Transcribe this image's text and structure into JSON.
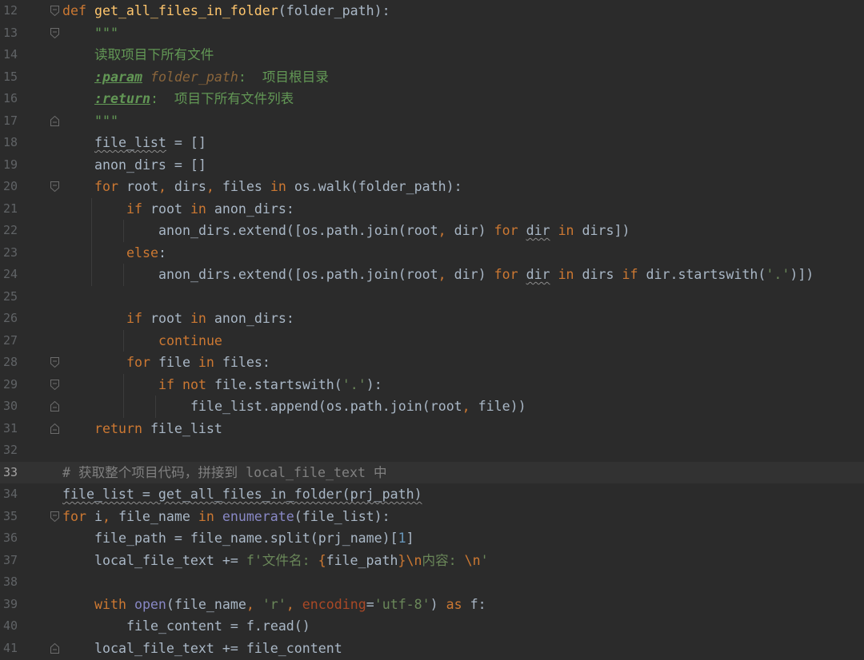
{
  "editor": {
    "lines": [
      {
        "n": "12",
        "fold": "open",
        "tokens": [
          [
            "kw",
            "def "
          ],
          [
            "fn",
            "get_all_files_in_folder"
          ],
          [
            "p",
            "(folder_path):"
          ]
        ]
      },
      {
        "n": "13",
        "fold": "open",
        "indent": 1,
        "tokens": [
          [
            "doc",
            "\"\"\""
          ]
        ]
      },
      {
        "n": "14",
        "indent": 1,
        "tokens": [
          [
            "doc",
            "读取项目下所有文件"
          ]
        ]
      },
      {
        "n": "15",
        "indent": 1,
        "tokens": [
          [
            "doctag",
            ":param"
          ],
          [
            "doc",
            " "
          ],
          [
            "docparam",
            "folder_path"
          ],
          [
            "doc",
            ":  项目根目录"
          ]
        ]
      },
      {
        "n": "16",
        "indent": 1,
        "tokens": [
          [
            "doctag",
            ":return"
          ],
          [
            "doc",
            ":  项目下所有文件列表"
          ]
        ]
      },
      {
        "n": "17",
        "fold": "close",
        "indent": 1,
        "tokens": [
          [
            "doc",
            "\"\"\""
          ]
        ]
      },
      {
        "n": "18",
        "indent": 1,
        "tokens": [
          [
            "warn",
            "file_list"
          ],
          [
            "p",
            " = []"
          ]
        ]
      },
      {
        "n": "19",
        "indent": 1,
        "tokens": [
          [
            "p",
            "anon_dirs = []"
          ]
        ]
      },
      {
        "n": "20",
        "fold": "open",
        "indent": 1,
        "tokens": [
          [
            "kw",
            "for "
          ],
          [
            "p",
            "root"
          ],
          [
            "kw",
            ", "
          ],
          [
            "p",
            "dirs"
          ],
          [
            "kw",
            ", "
          ],
          [
            "p",
            "files "
          ],
          [
            "kw",
            "in "
          ],
          [
            "p",
            "os.walk(folder_path):"
          ]
        ]
      },
      {
        "n": "21",
        "indent": 2,
        "tokens": [
          [
            "kw",
            "if "
          ],
          [
            "p",
            "root "
          ],
          [
            "kw",
            "in "
          ],
          [
            "p",
            "anon_dirs:"
          ]
        ]
      },
      {
        "n": "22",
        "indent": 3,
        "tokens": [
          [
            "p",
            "anon_dirs.extend([os.path.join(root"
          ],
          [
            "kw",
            ", "
          ],
          [
            "p",
            "dir) "
          ],
          [
            "kw",
            "for "
          ],
          [
            "warn",
            "dir"
          ],
          [
            "p",
            " "
          ],
          [
            "kw",
            "in "
          ],
          [
            "p",
            "dirs])"
          ]
        ]
      },
      {
        "n": "23",
        "indent": 2,
        "tokens": [
          [
            "kw",
            "else"
          ],
          [
            "p",
            ":"
          ]
        ]
      },
      {
        "n": "24",
        "indent": 3,
        "tokens": [
          [
            "p",
            "anon_dirs.extend([os.path.join(root"
          ],
          [
            "kw",
            ", "
          ],
          [
            "p",
            "dir) "
          ],
          [
            "kw",
            "for "
          ],
          [
            "warn",
            "dir"
          ],
          [
            "p",
            " "
          ],
          [
            "kw",
            "in "
          ],
          [
            "p",
            "dirs "
          ],
          [
            "kw",
            "if "
          ],
          [
            "p",
            "dir.startswith("
          ],
          [
            "str",
            "'.'"
          ],
          [
            "p",
            ")])"
          ]
        ]
      },
      {
        "n": "25",
        "indent": 0,
        "tokens": []
      },
      {
        "n": "26",
        "indent": 2,
        "tokens": [
          [
            "kw",
            "if "
          ],
          [
            "p",
            "root "
          ],
          [
            "kw",
            "in "
          ],
          [
            "p",
            "anon_dirs:"
          ]
        ]
      },
      {
        "n": "27",
        "indent": 3,
        "tokens": [
          [
            "kw",
            "continue"
          ]
        ]
      },
      {
        "n": "28",
        "fold": "open",
        "indent": 2,
        "tokens": [
          [
            "kw",
            "for "
          ],
          [
            "p",
            "file "
          ],
          [
            "kw",
            "in "
          ],
          [
            "p",
            "files:"
          ]
        ]
      },
      {
        "n": "29",
        "fold": "open",
        "indent": 3,
        "tokens": [
          [
            "kw",
            "if not "
          ],
          [
            "p",
            "file.startswith("
          ],
          [
            "str",
            "'.'"
          ],
          [
            "p",
            "):"
          ]
        ]
      },
      {
        "n": "30",
        "fold": "close",
        "indent": 4,
        "tokens": [
          [
            "p",
            "file_list.append(os.path.join(root"
          ],
          [
            "kw",
            ", "
          ],
          [
            "p",
            "file))"
          ]
        ]
      },
      {
        "n": "31",
        "fold": "close",
        "indent": 1,
        "tokens": [
          [
            "kw",
            "return "
          ],
          [
            "p",
            "file_list"
          ]
        ]
      },
      {
        "n": "32",
        "indent": 0,
        "tokens": []
      },
      {
        "n": "33",
        "current": true,
        "tokens": [
          [
            "cmt",
            "# 获取整个项目代码，拼接到 local_file_text 中"
          ]
        ]
      },
      {
        "n": "34",
        "tokens": [
          [
            "warn",
            "file_list = get_all_files_in_folder(prj_path)"
          ]
        ]
      },
      {
        "n": "35",
        "fold": "open",
        "tokens": [
          [
            "kw",
            "for "
          ],
          [
            "p",
            "i"
          ],
          [
            "kw",
            ", "
          ],
          [
            "p",
            "file_name "
          ],
          [
            "kw",
            "in "
          ],
          [
            "bi",
            "enumerate"
          ],
          [
            "p",
            "(file_list):"
          ]
        ]
      },
      {
        "n": "36",
        "indent": 1,
        "tokens": [
          [
            "p",
            "file_path = file_name.split(prj_name)["
          ],
          [
            "num",
            "1"
          ],
          [
            "p",
            "]"
          ]
        ]
      },
      {
        "n": "37",
        "indent": 1,
        "tokens": [
          [
            "p",
            "local_file_text += "
          ],
          [
            "str",
            "f'文件名: "
          ],
          [
            "fbr",
            "{"
          ],
          [
            "p",
            "file_path"
          ],
          [
            "fbr",
            "}"
          ],
          [
            "esc",
            "\\n"
          ],
          [
            "str",
            "内容: "
          ],
          [
            "esc",
            "\\n"
          ],
          [
            "str",
            "'"
          ]
        ]
      },
      {
        "n": "38",
        "indent": 0,
        "tokens": []
      },
      {
        "n": "39",
        "indent": 1,
        "tokens": [
          [
            "kw",
            "with "
          ],
          [
            "bi",
            "open"
          ],
          [
            "p",
            "(file_name"
          ],
          [
            "kw",
            ", "
          ],
          [
            "str",
            "'r'"
          ],
          [
            "kw",
            ", "
          ],
          [
            "kwarg",
            "encoding"
          ],
          [
            "p",
            "="
          ],
          [
            "str",
            "'utf-8'"
          ],
          [
            "p",
            ") "
          ],
          [
            "kw",
            "as "
          ],
          [
            "p",
            "f:"
          ]
        ]
      },
      {
        "n": "40",
        "indent": 2,
        "tokens": [
          [
            "p",
            "file_content = f.read()"
          ]
        ]
      },
      {
        "n": "41",
        "fold": "close",
        "indent": 1,
        "tokens": [
          [
            "p",
            "local_file_text += file_content"
          ]
        ]
      }
    ]
  },
  "icons": {
    "fold_open": "fold-open-icon",
    "fold_close": "fold-close-icon"
  },
  "colors": {
    "background": "#2b2b2b",
    "current_line": "#323232",
    "keyword": "#cc7832",
    "function": "#ffc66d",
    "string": "#6a8759"
  }
}
